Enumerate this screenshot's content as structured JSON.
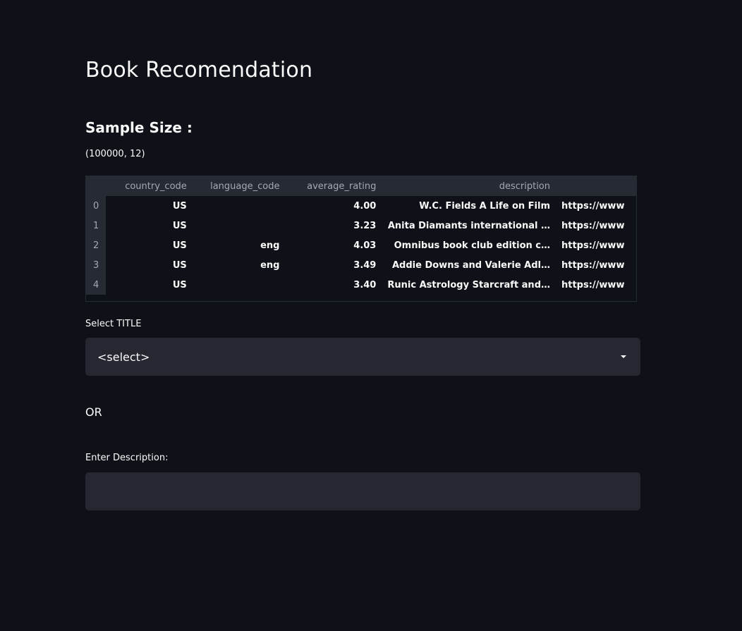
{
  "page": {
    "title": "Book Recomendation",
    "sample_heading": "Sample Size :",
    "sample_shape": "(100000, 12)"
  },
  "dataframe": {
    "columns": [
      "",
      "country_code",
      "language_code",
      "average_rating",
      "description",
      ""
    ],
    "rows": [
      {
        "index": "0",
        "country_code": "US",
        "language_code": "",
        "average_rating": "4.00",
        "description": "W.C. Fields A Life on Film",
        "url": "https://www"
      },
      {
        "index": "1",
        "country_code": "US",
        "language_code": "",
        "average_rating": "3.23",
        "description": "Anita Diamants international …",
        "url": "https://www"
      },
      {
        "index": "2",
        "country_code": "US",
        "language_code": "eng",
        "average_rating": "4.03",
        "description": "Omnibus book club edition c…",
        "url": "https://www"
      },
      {
        "index": "3",
        "country_code": "US",
        "language_code": "eng",
        "average_rating": "3.49",
        "description": "Addie Downs and Valerie Adl…",
        "url": "https://www"
      },
      {
        "index": "4",
        "country_code": "US",
        "language_code": "",
        "average_rating": "3.40",
        "description": "Runic Astrology Starcraft and…",
        "url": "https://www"
      }
    ]
  },
  "title_select": {
    "label": "Select TITLE",
    "value": "<select>",
    "icon": "chevron-down-icon"
  },
  "or_text": "OR",
  "description_input": {
    "label": "Enter Description:",
    "value": ""
  },
  "colors": {
    "background": "#0e1117",
    "widget_bg": "#262730",
    "text": "#fafafa"
  }
}
